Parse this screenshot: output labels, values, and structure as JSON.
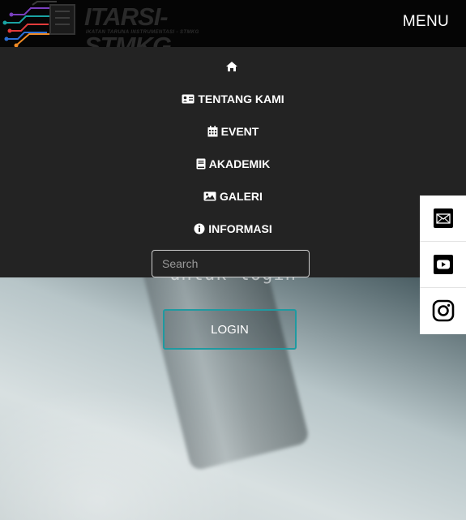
{
  "brand": {
    "title": "ITARSI-STMKG",
    "subtitle": "IKATAN TARUNA INSTRUMENTASI - STMKG"
  },
  "header": {
    "menu_label": "MENU"
  },
  "nav": {
    "items": [
      {
        "label": "",
        "icon": "home-icon"
      },
      {
        "label": "TENTANG KAMI",
        "icon": "id-card-icon"
      },
      {
        "label": "EVENT",
        "icon": "calendar-icon"
      },
      {
        "label": "AKADEMIK",
        "icon": "book-icon"
      },
      {
        "label": "GALERI",
        "icon": "image-icon"
      },
      {
        "label": "INFORMASI",
        "icon": "info-icon"
      }
    ],
    "search_placeholder": "Search"
  },
  "hero": {
    "text": "untuk login",
    "login_label": "LOGIN",
    "accent_color": "#1f9aa1"
  },
  "social": [
    {
      "icon": "mail-icon"
    },
    {
      "icon": "youtube-icon"
    },
    {
      "icon": "instagram-icon"
    }
  ]
}
